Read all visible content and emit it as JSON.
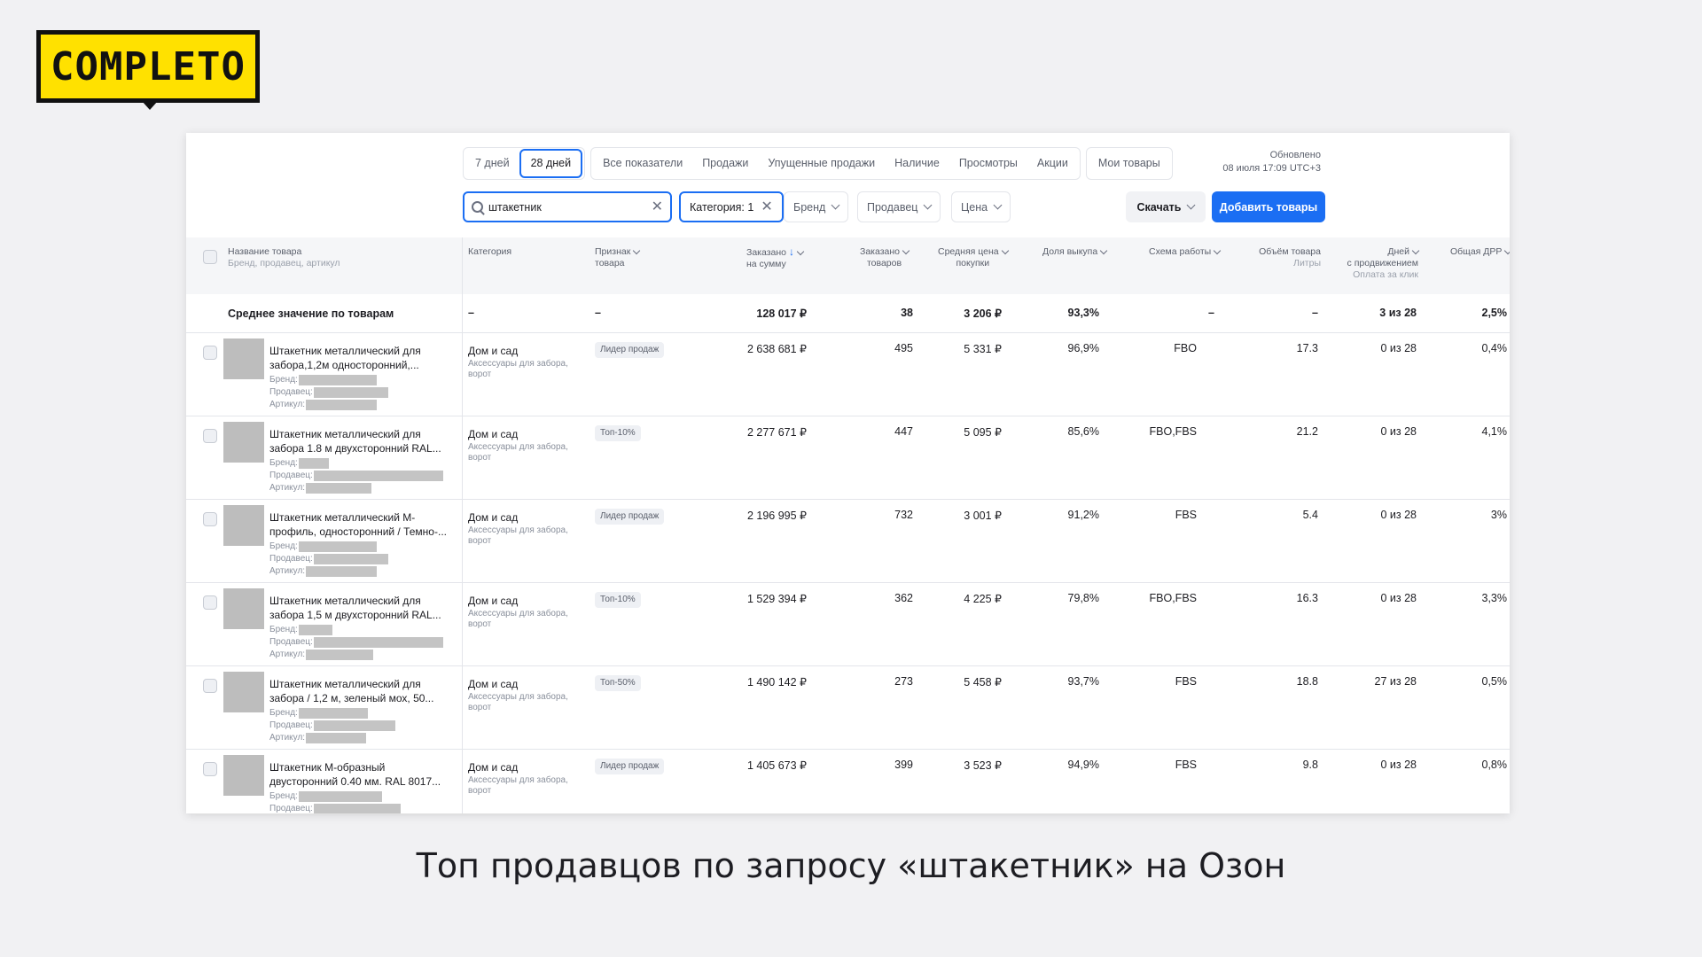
{
  "logo": {
    "text": "COMPLETO"
  },
  "tabs": {
    "periods": [
      "7 дней",
      "28 дней"
    ],
    "active_period": "28 дней",
    "views": [
      "Все показатели",
      "Продажи",
      "Упущенные продажи",
      "Наличие",
      "Просмотры",
      "Акции"
    ],
    "my_products": "Мои товары"
  },
  "updated": {
    "label": "Обновлено",
    "value": "08 июля 17:09 UTC+3"
  },
  "filters": {
    "search_value": "штакетник",
    "category": "Категория: 1",
    "brand": "Бренд",
    "seller": "Продавец",
    "price": "Цена",
    "download": "Скачать",
    "add_products": "Добавить товары"
  },
  "columns": {
    "name": "Название товара",
    "name_sub": "Бренд, продавец, артикул",
    "category": "Категория",
    "feature_1": "Признак",
    "feature_2": "товара",
    "ordered_sum_1": "Заказано",
    "ordered_sum_2": "на сумму",
    "ordered_qty_1": "Заказано",
    "ordered_qty_2": "товаров",
    "avg_price_1": "Средняя цена",
    "avg_price_2": "покупки",
    "buyout": "Доля выкупа",
    "scheme": "Схема работы",
    "volume": "Объём товара",
    "volume_sub": "Литры",
    "days_1": "Дней",
    "days_2": "с продвижением",
    "days_sub": "Оплата за клик",
    "drr": "Общая ДРР"
  },
  "average_row": {
    "label": "Среднее значение по товарам",
    "category": "–",
    "feature": "–",
    "ordered_sum": "128 017 ₽",
    "ordered_qty": "38",
    "avg_price": "3 206 ₽",
    "buyout": "93,3%",
    "scheme": "–",
    "volume": "–",
    "days": "3 из 28",
    "drr": "2,5%"
  },
  "meta_labels": {
    "brand": "Бренд:",
    "seller": "Продавец:",
    "article": "Артикул:"
  },
  "rows": [
    {
      "name1": "Штакетник металлический для",
      "name2": "забора,1,2м односторонний,...",
      "category": "Дом и сад",
      "category_sub": "Аксессуары для забора, ворот",
      "badge": "Лидер продаж",
      "ordered_sum": "2 638 681 ₽",
      "ordered_qty": "495",
      "avg_price": "5 331 ₽",
      "buyout": "96,9%",
      "scheme": "FBO",
      "volume": "17.3",
      "days": "0 из 28",
      "drr": "0,4%"
    },
    {
      "name1": "Штакетник металлический для",
      "name2": "забора 1.8 м двухсторонний RAL...",
      "category": "Дом и сад",
      "category_sub": "Аксессуары для забора, ворот",
      "badge": "Топ-10%",
      "ordered_sum": "2 277 671 ₽",
      "ordered_qty": "447",
      "avg_price": "5 095 ₽",
      "buyout": "85,6%",
      "scheme": "FBO,FBS",
      "volume": "21.2",
      "days": "0 из 28",
      "drr": "4,1%"
    },
    {
      "name1": "Штакетник металлический М-",
      "name2": "профиль, односторонний / Темно-...",
      "category": "Дом и сад",
      "category_sub": "Аксессуары для забора, ворот",
      "badge": "Лидер продаж",
      "ordered_sum": "2 196 995 ₽",
      "ordered_qty": "732",
      "avg_price": "3 001 ₽",
      "buyout": "91,2%",
      "scheme": "FBS",
      "volume": "5.4",
      "days": "0 из 28",
      "drr": "3%"
    },
    {
      "name1": "Штакетник металлический для",
      "name2": "забора 1,5 м двухсторонний RAL...",
      "category": "Дом и сад",
      "category_sub": "Аксессуары для забора, ворот",
      "badge": "Топ-10%",
      "ordered_sum": "1 529 394 ₽",
      "ordered_qty": "362",
      "avg_price": "4 225 ₽",
      "buyout": "79,8%",
      "scheme": "FBO,FBS",
      "volume": "16.3",
      "days": "0 из 28",
      "drr": "3,3%"
    },
    {
      "name1": "Штакетник металлический для",
      "name2": "забора / 1,2 м, зеленый мох, 50...",
      "category": "Дом и сад",
      "category_sub": "Аксессуары для забора, ворот",
      "badge": "Топ-50%",
      "ordered_sum": "1 490 142 ₽",
      "ordered_qty": "273",
      "avg_price": "5 458 ₽",
      "buyout": "93,7%",
      "scheme": "FBS",
      "volume": "18.8",
      "days": "27 из 28",
      "drr": "0,5%"
    },
    {
      "name1": "Штакетник М-образный",
      "name2": "двусторонний 0.40 мм. RAL 8017...",
      "category": "Дом и сад",
      "category_sub": "Аксессуары для забора, ворот",
      "badge": "Лидер продаж",
      "ordered_sum": "1 405 673 ₽",
      "ordered_qty": "399",
      "avg_price": "3 523 ₽",
      "buyout": "94,9%",
      "scheme": "FBS",
      "volume": "9.8",
      "days": "0 из 28",
      "drr": "0,8%"
    }
  ],
  "caption": "Топ продавцов по запросу «штакетник» на Озон"
}
